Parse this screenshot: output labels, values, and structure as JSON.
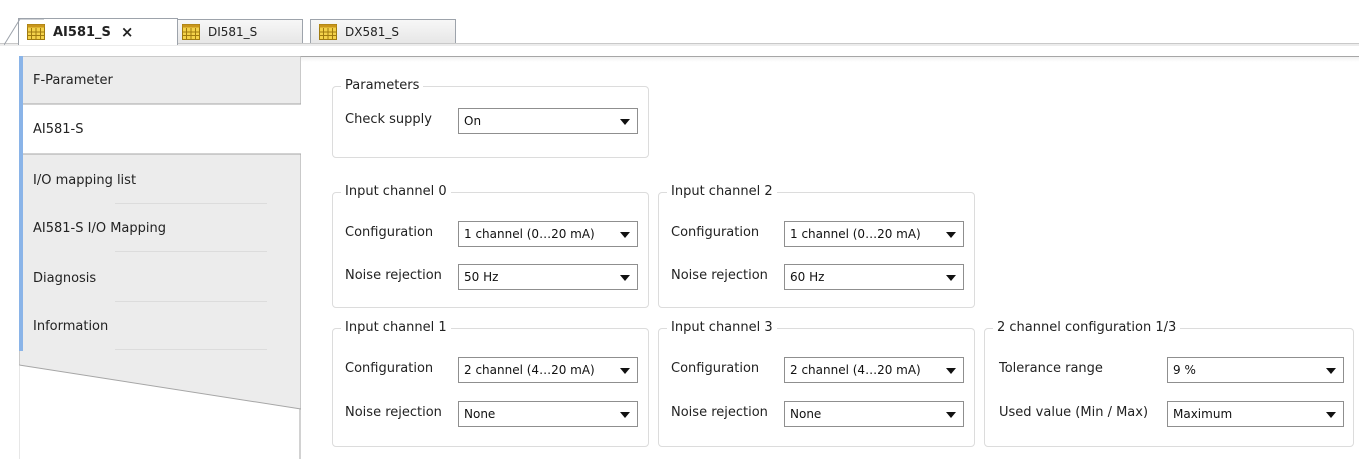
{
  "tabs": [
    {
      "label": "AI581_S",
      "active": true,
      "closable": true,
      "close_glyph": "×",
      "icon": "module-icon"
    },
    {
      "label": "DI581_S",
      "active": false,
      "icon": "module-icon"
    },
    {
      "label": "DX581_S",
      "active": false,
      "icon": "module-icon"
    }
  ],
  "nav": {
    "items": [
      {
        "label": "F-Parameter"
      },
      {
        "label": "AI581-S",
        "selected": true
      },
      {
        "label": "I/O mapping list"
      },
      {
        "label": "AI581-S I/O Mapping"
      },
      {
        "label": "Diagnosis"
      },
      {
        "label": "Information"
      }
    ]
  },
  "groups": {
    "parameters": {
      "title": "Parameters",
      "check_supply_label": "Check supply",
      "check_supply_value": "On"
    },
    "ch0": {
      "title": "Input channel 0",
      "config_label": "Configuration",
      "config_value": "1 channel (0…20 mA)",
      "noise_label": "Noise rejection",
      "noise_value": "50 Hz"
    },
    "ch2": {
      "title": "Input channel 2",
      "config_label": "Configuration",
      "config_value": "1 channel (0…20 mA)",
      "noise_label": "Noise rejection",
      "noise_value": "60 Hz"
    },
    "ch1": {
      "title": "Input channel 1",
      "config_label": "Configuration",
      "config_value": "2 channel (4…20 mA)",
      "noise_label": "Noise rejection",
      "noise_value": "None"
    },
    "ch3": {
      "title": "Input channel 3",
      "config_label": "Configuration",
      "config_value": "2 channel (4…20 mA)",
      "noise_label": "Noise rejection",
      "noise_value": "None"
    },
    "twochan": {
      "title": "2 channel configuration 1/3",
      "tolerance_label": "Tolerance range",
      "tolerance_value": "9 %",
      "used_value_label": "Used value (Min / Max)",
      "used_value_value": "Maximum"
    }
  },
  "colors": {
    "nav_accent": "#8ab4e8",
    "nav_bg": "#ececec",
    "icon_yellow": "#f4d24a"
  }
}
